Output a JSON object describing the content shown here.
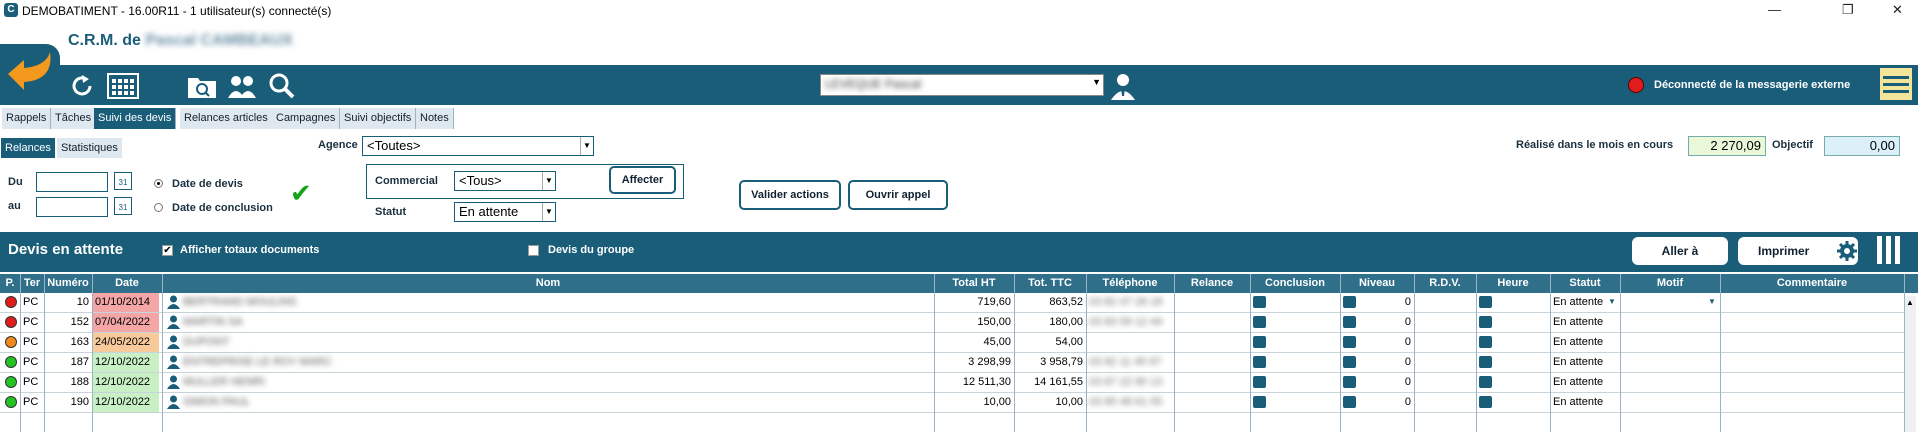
{
  "window": {
    "title": "DEMOBATIMENT - 16.00R11 - 1 utilisateur(s) connecté(s)",
    "app_icon_letter": "C",
    "min_glyph": "—",
    "max_glyph": "❐",
    "close_glyph": "✕"
  },
  "header": {
    "crm_label": "C.R.M. de",
    "crm_user_blurred": "Pascal CAMBEAUX",
    "user_select_blurred": "LEVEQUE Pascal",
    "messaging_status": "Déconnecté de la messagerie externe",
    "messaging_status_color": "#e01d1d"
  },
  "toolbar_icons": [
    "back-arrow-icon",
    "refresh-icon",
    "calculator-icon",
    "folder-search-icon",
    "contacts-icon",
    "search-icon",
    "user-icon",
    "menu-icon"
  ],
  "tabs": [
    {
      "label": "Rappels",
      "active": false
    },
    {
      "label": "Tâches",
      "active": false
    },
    {
      "label": "Suivi des devis",
      "active": true
    },
    {
      "label": "Relances articles",
      "active": false
    },
    {
      "label": "Campagnes",
      "active": false
    },
    {
      "label": "Suivi objectifs",
      "active": false
    },
    {
      "label": "Notes",
      "active": false
    }
  ],
  "subtabs": [
    {
      "label": "Relances",
      "active": true
    },
    {
      "label": "Statistiques",
      "active": false
    }
  ],
  "filters": {
    "agence_label": "Agence",
    "agence_value": "<Toutes>",
    "realise_label": "Réalisé dans le mois en cours",
    "realise_value": "2 270,09",
    "objectif_label": "Objectif",
    "objectif_value": "0,00",
    "du_label": "Du",
    "au_label": "au",
    "du_value": "",
    "au_value": "",
    "calendar_day": "31",
    "radio_devis": "Date de devis",
    "radio_conclusion": "Date de conclusion",
    "radio_selected": "Date de devis",
    "commercial_label": "Commercial",
    "commercial_value": "<Tous>",
    "affecter_button": "Affecter",
    "statut_label": "Statut",
    "statut_value": "En attente",
    "valider_button": "Valider actions",
    "ouvrir_button": "Ouvrir appel",
    "checkmark": "✔"
  },
  "list": {
    "title": "Devis en attente",
    "afficher_totaux_label": "Afficher totaux documents",
    "afficher_totaux_checked": true,
    "devis_groupe_label": "Devis du groupe",
    "devis_groupe_checked": false,
    "aller_button": "Aller à",
    "imprimer_button": "Imprimer"
  },
  "grid": {
    "columns": [
      "P.",
      "Ter",
      "Numéro",
      "Date",
      "Nom",
      "Total HT",
      "Tot. TTC",
      "Téléphone",
      "Relance",
      "Conclusion",
      "Niveau",
      "R.D.V.",
      "Heure",
      "Statut",
      "Motif",
      "Commentaire"
    ],
    "rows": [
      {
        "dot": "#e01d1d",
        "ter": "PC",
        "num": "10",
        "date": "01/10/2014",
        "date_bg": "#f4a6a6",
        "nom": "BERTRAND MOULINS",
        "ht": "719,60",
        "ttc": "863,52",
        "tel": "03 82 47 26 18",
        "niveau": "0",
        "statut": "En attente"
      },
      {
        "dot": "#e01d1d",
        "ter": "PC",
        "num": "152",
        "date": "07/04/2022",
        "date_bg": "#f4a6a6",
        "nom": "MARTIN SA",
        "ht": "150,00",
        "ttc": "180,00",
        "tel": "03 83 59 12 44",
        "niveau": "0",
        "statut": "En attente"
      },
      {
        "dot": "#f08a1d",
        "ter": "PC",
        "num": "163",
        "date": "24/05/2022",
        "date_bg": "#f8c99a",
        "nom": "DUPONT",
        "ht": "45,00",
        "ttc": "54,00",
        "tel": "",
        "niveau": "0",
        "statut": "En attente"
      },
      {
        "dot": "#22c422",
        "ter": "PC",
        "num": "187",
        "date": "12/10/2022",
        "date_bg": "#c9f0c4",
        "nom": "ENTREPRISE LE ROY MARC",
        "ht": "3 298,99",
        "ttc": "3 958,79",
        "tel": "03 82 11 45 67",
        "niveau": "0",
        "statut": "En attente"
      },
      {
        "dot": "#22c422",
        "ter": "PC",
        "num": "188",
        "date": "12/10/2022",
        "date_bg": "#c9f0c4",
        "nom": "MULLER HENRI",
        "ht": "12 511,30",
        "ttc": "14 161,55",
        "tel": "03 87 22 90 13",
        "niveau": "0",
        "statut": "En attente"
      },
      {
        "dot": "#22c422",
        "ter": "PC",
        "num": "190",
        "date": "12/10/2022",
        "date_bg": "#c9f0c4",
        "nom": "SIMON PAUL",
        "ht": "10,00",
        "ttc": "10,00",
        "tel": "03 85 48 61 55",
        "niveau": "0",
        "statut": "En attente"
      }
    ]
  }
}
